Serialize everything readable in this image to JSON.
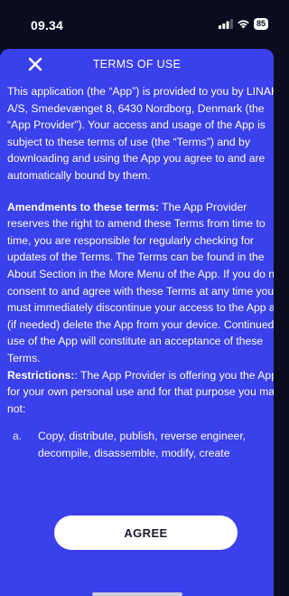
{
  "status_bar": {
    "time": "09.34",
    "battery": "85"
  },
  "header": {
    "title": "TERMS OF USE"
  },
  "terms": {
    "intro": "This application (the “App”) is provided to you by LINAK A/S, Smedevænget 8, 6430 Nordborg, Denmark (the “App Provider”). Your access and usage of the App is subject to these terms of use (the “Terms”) and by downloading and using the App you agree to and are automatically bound by them.",
    "amendments_heading": "Amendments to these terms:",
    "amendments_text": " The App Provider reserves the right to amend these Terms from time to time, you are responsible for regularly checking for updates of the Terms. The Terms can be found in the About Section in the More Menu of the App. If you do not consent to and agree with these Terms at any time you must immediately discontinue your access to the App and (if needed) delete the App from your device. Continued use of the App will constitute an acceptance of these Terms.",
    "restrictions_heading": "Restrictions:",
    "restrictions_text": ": The App Provider is offering you the App for your own personal use and for that purpose you may not:",
    "list": [
      {
        "marker": "a.",
        "text": "Copy, distribute, publish, reverse engineer, decompile, disassemble, modify, create"
      }
    ]
  },
  "actions": {
    "agree_label": "AGREE"
  },
  "icons": {
    "close": "close-icon",
    "signal": "signal-icon",
    "wifi": "wifi-icon",
    "battery": "battery-icon"
  },
  "colors": {
    "sheet_background": "#3a40ea",
    "screen_background": "#0b0c1f",
    "button_background": "#ffffff"
  }
}
